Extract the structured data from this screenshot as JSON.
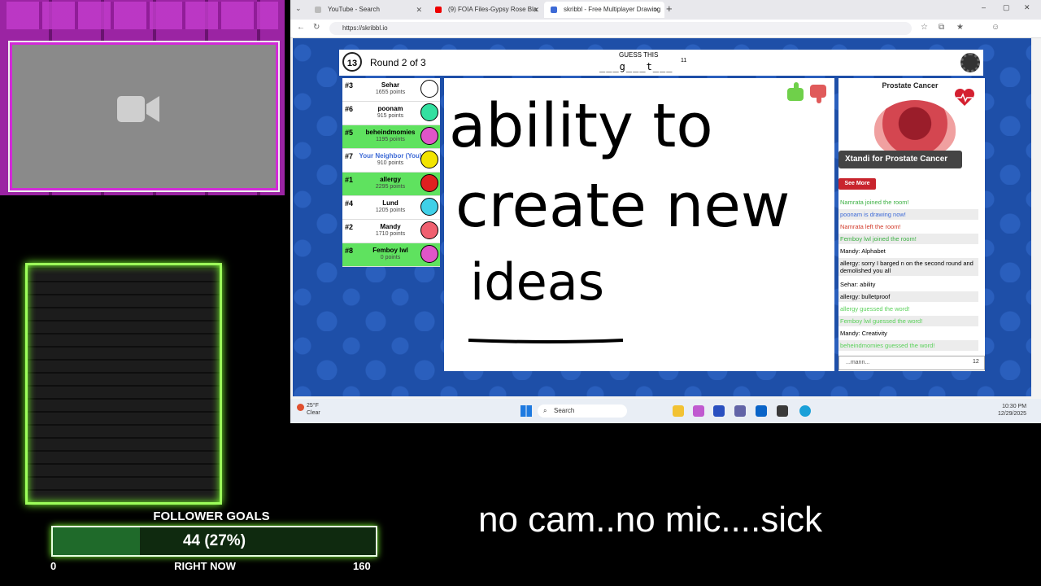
{
  "browser": {
    "tabs": [
      {
        "title": "YouTube - Search"
      },
      {
        "title": "(9) FOIA Files-Gypsy Rose Bla"
      },
      {
        "title": "skribbl - Free Multiplayer Drawing"
      }
    ],
    "url": "https://skribbl.io"
  },
  "game": {
    "timer": "13",
    "round": "Round 2 of 3",
    "guess_label": "GUESS THIS",
    "word_hint": "___g___t___",
    "word_length": "11",
    "players": [
      {
        "rank": "#3",
        "name": "Sehar",
        "points": "1655 points",
        "highlight": false,
        "avatar_color": "#ffffff"
      },
      {
        "rank": "#6",
        "name": "poonam",
        "points": "915 points",
        "highlight": false,
        "avatar_color": "#33e0a0"
      },
      {
        "rank": "#5",
        "name": "beheindmomies",
        "points": "1195 points",
        "highlight": true,
        "avatar_color": "#e055c8"
      },
      {
        "rank": "#7",
        "name": "Your Neighbor (You)",
        "points": "910 points",
        "highlight": false,
        "avatar_color": "#f2e400"
      },
      {
        "rank": "#1",
        "name": "allergy",
        "points": "2295 points",
        "highlight": true,
        "avatar_color": "#e02020"
      },
      {
        "rank": "#4",
        "name": "Lund",
        "points": "1205 points",
        "highlight": false,
        "avatar_color": "#40d0e8"
      },
      {
        "rank": "#2",
        "name": "Mandy",
        "points": "1710 points",
        "highlight": false,
        "avatar_color": "#f06070"
      },
      {
        "rank": "#8",
        "name": "Femboy lwl",
        "points": "0 points",
        "highlight": true,
        "avatar_color": "#e055c8"
      }
    ],
    "drawing_lines": [
      "ability to",
      "create new",
      "ideas"
    ],
    "chat": [
      {
        "text": "Namrata joined the room!",
        "color": "#3cb043",
        "alt": false
      },
      {
        "text": "poonam is drawing now!",
        "color": "#3d6ad6",
        "alt": true
      },
      {
        "text": "Namrata left the room!",
        "color": "#d23a2a",
        "alt": false
      },
      {
        "text": "Femboy lwl joined the room!",
        "color": "#3cb043",
        "alt": true
      },
      {
        "text": "Mandy: Alphabet",
        "color": "#000000",
        "alt": false
      },
      {
        "text": "allergy: sorry I barged n on the second round and demolished you all",
        "color": "#000000",
        "alt": true
      },
      {
        "text": "Sehar: ability",
        "color": "#000000",
        "alt": false
      },
      {
        "text": "allergy: bulletproof",
        "color": "#000000",
        "alt": true
      },
      {
        "text": "allergy guessed the word!",
        "color": "#5ad15a",
        "alt": false
      },
      {
        "text": "Femboy lwl guessed the word!",
        "color": "#5ad15a",
        "alt": true
      },
      {
        "text": "Mandy: Creativity",
        "color": "#000000",
        "alt": false
      },
      {
        "text": "beheindmomies guessed the word!",
        "color": "#5ad15a",
        "alt": true
      }
    ],
    "chat_input": "...mann...",
    "chat_char_count": "12"
  },
  "ad": {
    "title": "Prostate Cancer",
    "banner": "Xtandi for Prostate Cancer",
    "button": "See More"
  },
  "taskbar": {
    "weather_temp": "25°F",
    "weather_desc": "Clear",
    "search_label": "Search",
    "time": "10:30 PM",
    "date": "12/29/2025"
  },
  "overlay": {
    "goals_title": "FOLLOWER GOALS",
    "goal_value_text": "44 (27%)",
    "goal_fraction": 0.27,
    "goal_min": "0",
    "goal_label": "RIGHT NOW",
    "goal_max": "160",
    "status_message": "no cam..no mic....sick"
  },
  "colors": {
    "game_bg": "#1e4fa8",
    "player_highlight": "#5fe25f",
    "neon_green": "#9dff5a",
    "cam_frame": "#c33ccd"
  }
}
